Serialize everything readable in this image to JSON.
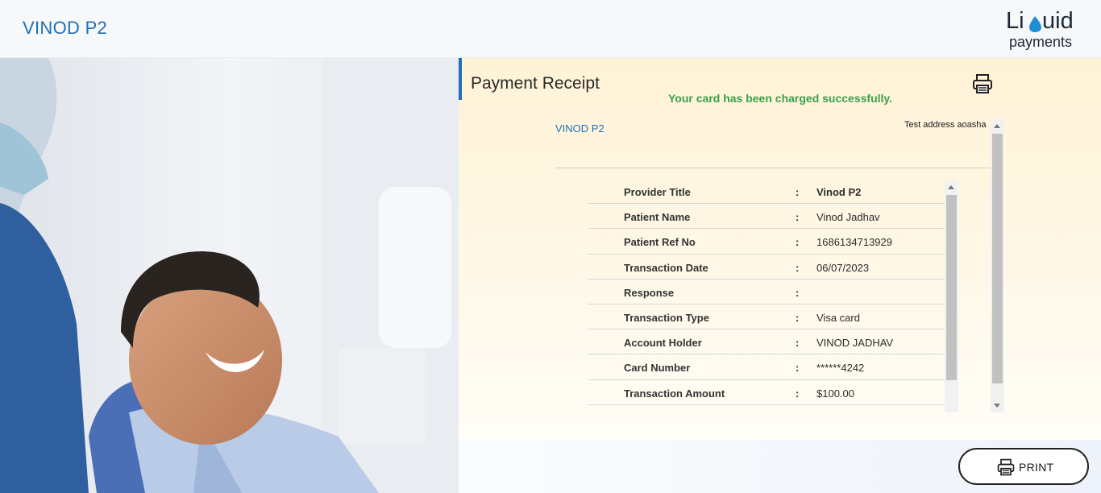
{
  "header": {
    "provider_name": "VINOD P2",
    "logo": {
      "line1": "Liquid",
      "line2": "payments",
      "accent_color": "#1f8fd6"
    }
  },
  "receipt": {
    "title": "Payment Receipt",
    "success_message": "Your card has been charged successfully.",
    "clinic_name": "VINOD P2",
    "address": "Test address aoasha",
    "rows": [
      {
        "label": "Provider Title",
        "value": "Vinod P2"
      },
      {
        "label": "Patient Name",
        "value": "Vinod Jadhav"
      },
      {
        "label": "Patient Ref No",
        "value": "1686134713929"
      },
      {
        "label": "Transaction Date",
        "value": "06/07/2023"
      },
      {
        "label": "Response",
        "value": ""
      },
      {
        "label": "Transaction Type",
        "value": "Visa card"
      },
      {
        "label": "Account Holder",
        "value": "VINOD JADHAV"
      },
      {
        "label": "Card Number",
        "value": "******4242"
      },
      {
        "label": "Transaction Amount",
        "value": "$100.00"
      }
    ],
    "separator": ":"
  },
  "footer": {
    "print_label": "PRINT"
  },
  "colors": {
    "brand_blue": "#1f6fb6",
    "success_green": "#3aa04a",
    "panel_bg": "#fff3d6"
  },
  "icons": {
    "print": "printer-icon",
    "scroll_up": "chevron-up-icon",
    "scroll_down": "chevron-down-icon"
  }
}
